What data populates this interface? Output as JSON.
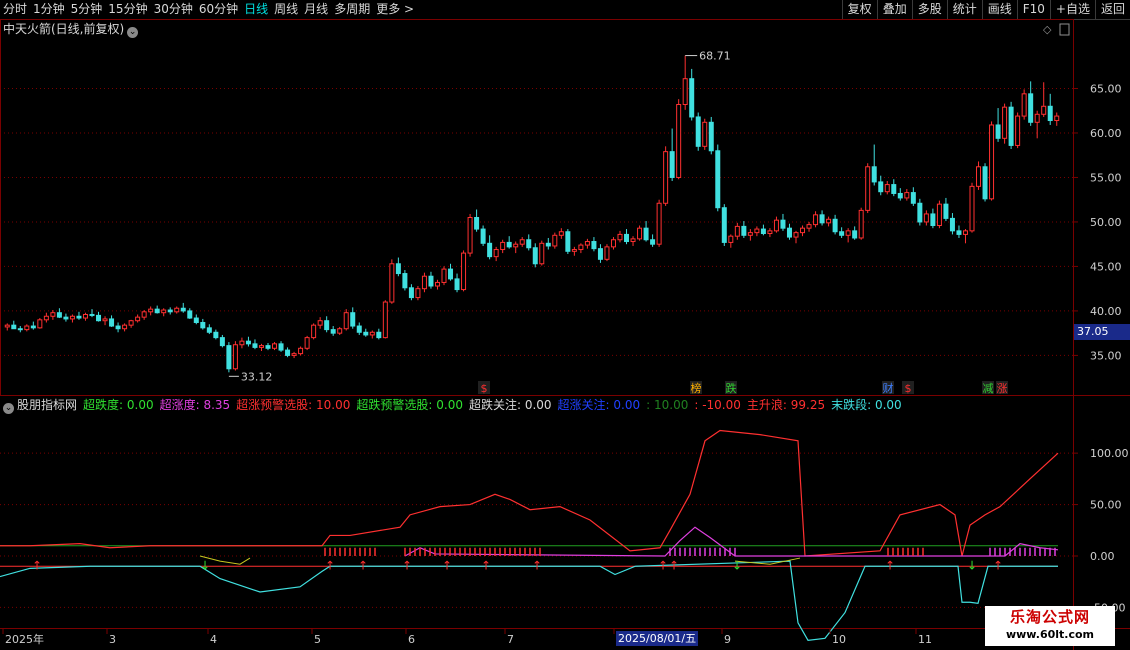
{
  "toolbar": {
    "left": [
      "分时",
      "1分钟",
      "5分钟",
      "15分钟",
      "30分钟",
      "60分钟",
      "日线",
      "周线",
      "月线",
      "多周期",
      "更多 >"
    ],
    "active_index": 6,
    "right": [
      "复权",
      "叠加",
      "多股",
      "统计",
      "画线",
      "F10",
      "+自选",
      "返回"
    ]
  },
  "main_title": "中天火箭(日线,前复权)",
  "price_axis": [
    "65.00",
    "60.00",
    "55.00",
    "50.00",
    "45.00",
    "40.00",
    "35.00"
  ],
  "current_price": "37.05",
  "high_label": "68.71",
  "low_label": "33.12",
  "event_markers": [
    {
      "text": "$",
      "color": "#ff3030"
    },
    {
      "text": "榜",
      "color": "#ffb000"
    },
    {
      "text": "跌",
      "color": "#30d030"
    },
    {
      "text": "财",
      "color": "#4080ff"
    },
    {
      "text": "$",
      "color": "#ff3030"
    },
    {
      "text": "减",
      "color": "#30d030"
    },
    {
      "text": "涨",
      "color": "#ff3030"
    }
  ],
  "indicator": {
    "name": "股朋指标网",
    "fields": [
      {
        "label": "超跌度: 0.00",
        "color": "#30e030"
      },
      {
        "label": "超涨度: 8.35",
        "color": "#e040e0"
      },
      {
        "label": "超涨预警选股: 10.00",
        "color": "#ff3030"
      },
      {
        "label": "超跌预警选股: 0.00",
        "color": "#30e030"
      },
      {
        "label": "超跌关注: 0.00",
        "color": "#d8d8d8"
      },
      {
        "label": "超涨关注: 0.00",
        "color": "#2040ff"
      },
      {
        "label": ": 10.00",
        "color": "#208020"
      },
      {
        "label": ": -10.00",
        "color": "#ff3030"
      },
      {
        "label": "主升浪: 99.25",
        "color": "#ff3030"
      },
      {
        "label": "末跌段: 0.00",
        "color": "#40e0e0"
      }
    ]
  },
  "indicator_axis": [
    "100.00",
    "50.00",
    "0.00",
    "-50.00"
  ],
  "time_axis": [
    "2025年",
    "3",
    "4",
    "5",
    "6",
    "7",
    "8",
    "9",
    "10",
    "11"
  ],
  "selected_date": "2025/08/01/五",
  "watermark": {
    "line1": "乐淘公式网",
    "line2": "www.60lt.com"
  },
  "colors": {
    "up": "#ff3030",
    "down": "#40e0e0",
    "grid": "#7a0000",
    "axis": "#7a0000"
  },
  "chart_data": {
    "type": "candlestick",
    "ylim": [
      31,
      70
    ],
    "candles": [
      [
        38.2,
        38.6,
        37.8,
        38.4
      ],
      [
        38.4,
        38.9,
        38.1,
        38.0
      ],
      [
        38.0,
        38.3,
        37.6,
        37.9
      ],
      [
        37.9,
        38.5,
        37.7,
        38.3
      ],
      [
        38.3,
        38.8,
        37.9,
        38.1
      ],
      [
        38.1,
        39.2,
        38.0,
        39.0
      ],
      [
        39.0,
        39.8,
        38.7,
        39.4
      ],
      [
        39.4,
        40.1,
        39.0,
        39.8
      ],
      [
        39.8,
        40.3,
        39.2,
        39.3
      ],
      [
        39.3,
        39.7,
        38.8,
        39.1
      ],
      [
        39.1,
        39.6,
        38.7,
        39.4
      ],
      [
        39.4,
        39.9,
        39.0,
        39.2
      ],
      [
        39.2,
        39.8,
        38.9,
        39.6
      ],
      [
        39.6,
        40.2,
        39.3,
        39.5
      ],
      [
        39.5,
        39.9,
        38.8,
        38.9
      ],
      [
        38.9,
        39.4,
        38.4,
        39.1
      ],
      [
        39.1,
        39.5,
        38.2,
        38.3
      ],
      [
        38.3,
        38.7,
        37.6,
        38.0
      ],
      [
        38.0,
        38.6,
        37.7,
        38.4
      ],
      [
        38.4,
        39.0,
        38.1,
        38.9
      ],
      [
        38.9,
        39.6,
        38.7,
        39.3
      ],
      [
        39.3,
        40.1,
        39.0,
        39.9
      ],
      [
        39.9,
        40.5,
        39.5,
        40.2
      ],
      [
        40.2,
        40.6,
        39.7,
        39.8
      ],
      [
        39.8,
        40.3,
        39.4,
        40.1
      ],
      [
        40.1,
        40.4,
        39.6,
        39.9
      ],
      [
        39.9,
        40.5,
        39.7,
        40.3
      ],
      [
        40.3,
        40.9,
        39.8,
        40.0
      ],
      [
        40.0,
        40.3,
        39.1,
        39.2
      ],
      [
        39.2,
        39.6,
        38.5,
        38.7
      ],
      [
        38.7,
        39.1,
        37.9,
        38.1
      ],
      [
        38.1,
        38.5,
        37.4,
        37.6
      ],
      [
        37.6,
        37.9,
        36.8,
        37.0
      ],
      [
        37.0,
        37.3,
        35.9,
        36.1
      ],
      [
        36.1,
        36.5,
        33.1,
        33.5
      ],
      [
        33.5,
        36.6,
        33.3,
        36.2
      ],
      [
        36.2,
        37.0,
        35.8,
        36.6
      ],
      [
        36.6,
        37.1,
        36.0,
        36.3
      ],
      [
        36.3,
        36.8,
        35.7,
        35.9
      ],
      [
        35.9,
        36.3,
        35.5,
        36.1
      ],
      [
        36.1,
        36.4,
        35.6,
        35.8
      ],
      [
        35.8,
        36.5,
        35.6,
        36.3
      ],
      [
        36.3,
        36.6,
        35.4,
        35.6
      ],
      [
        35.6,
        35.9,
        34.8,
        35.0
      ],
      [
        35.0,
        35.4,
        34.7,
        35.2
      ],
      [
        35.2,
        36.0,
        35.0,
        35.8
      ],
      [
        35.8,
        37.2,
        35.6,
        37.0
      ],
      [
        37.0,
        38.6,
        36.8,
        38.4
      ],
      [
        38.4,
        39.3,
        38.0,
        38.9
      ],
      [
        38.9,
        39.4,
        37.6,
        37.9
      ],
      [
        37.9,
        38.3,
        37.2,
        37.5
      ],
      [
        37.5,
        38.2,
        37.3,
        38.0
      ],
      [
        38.0,
        40.2,
        37.8,
        39.8
      ],
      [
        39.8,
        40.4,
        38.0,
        38.3
      ],
      [
        38.3,
        38.7,
        37.3,
        37.6
      ],
      [
        37.6,
        38.0,
        37.1,
        37.3
      ],
      [
        37.3,
        37.8,
        36.9,
        37.6
      ],
      [
        37.6,
        38.0,
        36.8,
        37.0
      ],
      [
        37.0,
        41.2,
        36.9,
        41.0
      ],
      [
        41.0,
        45.8,
        40.8,
        45.3
      ],
      [
        45.3,
        46.0,
        43.9,
        44.2
      ],
      [
        44.2,
        44.6,
        42.3,
        42.6
      ],
      [
        42.6,
        43.0,
        41.2,
        41.5
      ],
      [
        41.5,
        42.8,
        41.2,
        42.5
      ],
      [
        42.5,
        44.3,
        42.1,
        43.9
      ],
      [
        43.9,
        44.4,
        42.5,
        42.8
      ],
      [
        42.8,
        43.5,
        42.4,
        43.2
      ],
      [
        43.2,
        45.0,
        42.9,
        44.7
      ],
      [
        44.7,
        45.3,
        43.4,
        43.6
      ],
      [
        43.6,
        44.2,
        42.1,
        42.4
      ],
      [
        42.4,
        46.8,
        42.2,
        46.5
      ],
      [
        46.5,
        50.9,
        46.1,
        50.5
      ],
      [
        50.5,
        51.4,
        48.9,
        49.2
      ],
      [
        49.2,
        49.6,
        47.3,
        47.6
      ],
      [
        47.6,
        48.5,
        45.8,
        46.1
      ],
      [
        46.1,
        47.2,
        45.6,
        46.9
      ],
      [
        46.9,
        48.0,
        46.5,
        47.7
      ],
      [
        47.7,
        48.4,
        47.0,
        47.2
      ],
      [
        47.2,
        47.8,
        46.5,
        47.5
      ],
      [
        47.5,
        48.3,
        47.2,
        48.0
      ],
      [
        48.0,
        48.6,
        46.8,
        47.1
      ],
      [
        47.1,
        47.6,
        44.9,
        45.3
      ],
      [
        45.3,
        47.9,
        45.1,
        47.6
      ],
      [
        47.6,
        48.2,
        46.9,
        47.3
      ],
      [
        47.3,
        48.8,
        47.0,
        48.5
      ],
      [
        48.5,
        49.3,
        48.1,
        48.9
      ],
      [
        48.9,
        49.2,
        46.4,
        46.7
      ],
      [
        46.7,
        47.2,
        46.2,
        46.9
      ],
      [
        46.9,
        47.6,
        46.5,
        47.4
      ],
      [
        47.4,
        48.1,
        47.0,
        47.8
      ],
      [
        47.8,
        48.3,
        46.7,
        47.0
      ],
      [
        47.0,
        47.5,
        45.4,
        45.8
      ],
      [
        45.8,
        47.5,
        45.6,
        47.2
      ],
      [
        47.2,
        48.3,
        46.9,
        48.0
      ],
      [
        48.0,
        49.0,
        47.7,
        48.6
      ],
      [
        48.6,
        49.2,
        47.5,
        47.8
      ],
      [
        47.8,
        48.4,
        47.3,
        48.1
      ],
      [
        48.1,
        49.6,
        47.9,
        49.3
      ],
      [
        49.3,
        50.1,
        47.8,
        48.0
      ],
      [
        48.0,
        48.6,
        47.2,
        47.5
      ],
      [
        47.5,
        52.5,
        47.2,
        52.1
      ],
      [
        52.1,
        58.5,
        51.8,
        57.9
      ],
      [
        57.9,
        60.5,
        54.6,
        55.0
      ],
      [
        55.0,
        63.8,
        54.8,
        63.2
      ],
      [
        63.2,
        68.7,
        62.6,
        66.1
      ],
      [
        66.1,
        67.2,
        61.4,
        61.8
      ],
      [
        61.8,
        62.3,
        58.0,
        58.5
      ],
      [
        58.5,
        61.6,
        58.1,
        61.2
      ],
      [
        61.2,
        61.8,
        57.6,
        58.0
      ],
      [
        58.0,
        58.7,
        51.2,
        51.6
      ],
      [
        51.6,
        52.0,
        47.3,
        47.7
      ],
      [
        47.7,
        48.6,
        47.1,
        48.4
      ],
      [
        48.4,
        49.9,
        48.0,
        49.5
      ],
      [
        49.5,
        50.1,
        48.2,
        48.5
      ],
      [
        48.5,
        49.2,
        47.9,
        48.8
      ],
      [
        48.8,
        49.5,
        48.4,
        49.2
      ],
      [
        49.2,
        49.7,
        48.5,
        48.7
      ],
      [
        48.7,
        49.3,
        48.3,
        49.0
      ],
      [
        49.0,
        50.6,
        48.8,
        50.2
      ],
      [
        50.2,
        50.9,
        49.0,
        49.3
      ],
      [
        49.3,
        49.8,
        48.0,
        48.3
      ],
      [
        48.3,
        49.0,
        47.6,
        48.8
      ],
      [
        48.8,
        49.6,
        48.4,
        49.3
      ],
      [
        49.3,
        50.0,
        48.9,
        49.7
      ],
      [
        49.7,
        51.2,
        49.4,
        50.8
      ],
      [
        50.8,
        51.3,
        49.6,
        49.9
      ],
      [
        49.9,
        50.6,
        49.5,
        50.3
      ],
      [
        50.3,
        50.8,
        48.6,
        48.9
      ],
      [
        48.9,
        49.4,
        48.2,
        48.5
      ],
      [
        48.5,
        49.3,
        47.7,
        49.0
      ],
      [
        49.0,
        49.5,
        48.0,
        48.2
      ],
      [
        48.2,
        51.6,
        48.0,
        51.3
      ],
      [
        51.3,
        56.6,
        51.0,
        56.2
      ],
      [
        56.2,
        58.7,
        54.1,
        54.5
      ],
      [
        54.5,
        55.2,
        53.0,
        53.4
      ],
      [
        53.4,
        54.6,
        53.1,
        54.2
      ],
      [
        54.2,
        54.8,
        52.9,
        53.2
      ],
      [
        53.2,
        53.8,
        52.4,
        52.7
      ],
      [
        52.7,
        53.7,
        52.4,
        53.3
      ],
      [
        53.3,
        53.9,
        51.8,
        52.1
      ],
      [
        52.1,
        52.6,
        49.6,
        50.0
      ],
      [
        50.0,
        51.3,
        49.6,
        50.9
      ],
      [
        50.9,
        51.5,
        49.3,
        49.6
      ],
      [
        49.6,
        52.4,
        49.3,
        52.0
      ],
      [
        52.0,
        52.7,
        50.1,
        50.4
      ],
      [
        50.4,
        51.0,
        48.6,
        49.0
      ],
      [
        49.0,
        49.6,
        48.2,
        48.6
      ],
      [
        48.6,
        49.2,
        47.6,
        49.0
      ],
      [
        49.0,
        54.4,
        48.8,
        54.0
      ],
      [
        54.0,
        56.8,
        53.6,
        56.2
      ],
      [
        56.2,
        56.6,
        52.3,
        52.6
      ],
      [
        52.6,
        61.3,
        52.4,
        60.9
      ],
      [
        60.9,
        62.8,
        59.0,
        59.4
      ],
      [
        59.4,
        63.3,
        58.8,
        62.9
      ],
      [
        62.9,
        63.5,
        58.2,
        58.6
      ],
      [
        58.6,
        62.3,
        58.3,
        61.9
      ],
      [
        61.9,
        64.9,
        61.5,
        64.4
      ],
      [
        64.4,
        65.8,
        60.8,
        61.2
      ],
      [
        61.2,
        62.5,
        59.4,
        62.1
      ],
      [
        62.1,
        65.7,
        61.8,
        63.0
      ],
      [
        63.0,
        64.4,
        60.9,
        61.4
      ],
      [
        61.4,
        62.3,
        60.8,
        61.9
      ]
    ],
    "indicator_ylim": [
      -70,
      140
    ]
  }
}
